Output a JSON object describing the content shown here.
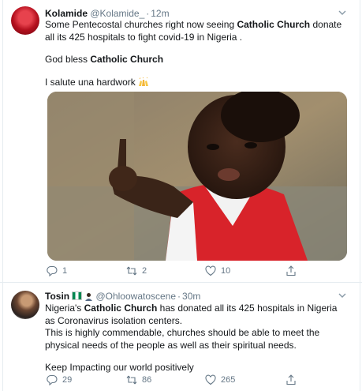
{
  "tweets": [
    {
      "author": {
        "name": "Kolamide",
        "handle": "@Kolamide_",
        "time": "12m"
      },
      "text": {
        "line1_a": "Some Pentecostal churches right now seeing ",
        "line1_b": "Catholic Church",
        "line1_c": " donate all its 425 hospitals to fight covid-19 in Nigeria .",
        "line2_a": "God bless ",
        "line2_b": "Catholic Church",
        "line3": "I salute una hardwork",
        "emoji": "raising-hands"
      },
      "stats": {
        "replies": "1",
        "retweets": "2",
        "likes": "10"
      },
      "media_alt": "photo-crying-child-pointing"
    },
    {
      "author": {
        "name": "Tosin",
        "handle": "@Ohloowatoscene",
        "time": "30m",
        "badges": [
          "nigeria-flag",
          "person-emoji"
        ]
      },
      "text": {
        "line1_a": "Nigeria's ",
        "line1_b": "Catholic Church",
        "line1_c": " has donated all its 425 hospitals in Nigeria as Coronavirus isolation centers.",
        "line2": "This is highly commendable, churches should be able to meet the physical needs of the people as well as their spiritual needs.",
        "line3": "Keep Impacting our world positively"
      },
      "stats": {
        "replies": "29",
        "retweets": "86",
        "likes": "265"
      }
    }
  ],
  "colors": {
    "meta": "#657786",
    "text": "#14171a",
    "border": "#e6ecf0"
  },
  "icons": [
    "chevron-down-icon",
    "reply-icon",
    "retweet-icon",
    "like-icon",
    "share-icon"
  ]
}
